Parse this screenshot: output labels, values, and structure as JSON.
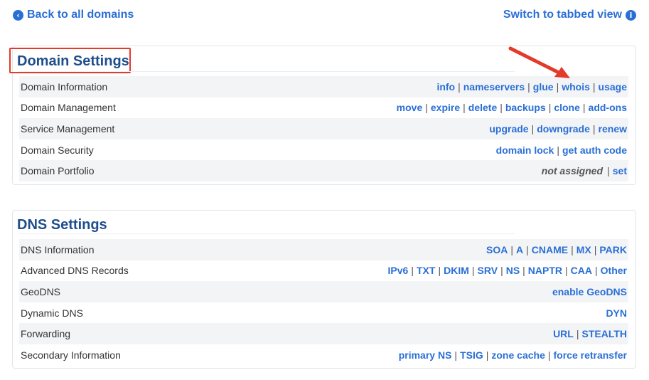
{
  "top": {
    "back_label": "Back to all domains",
    "back_icon": "chevron-left-icon",
    "switch_label": "Switch to tabbed view",
    "switch_icon": "info-icon"
  },
  "domain_settings": {
    "title": "Domain Settings",
    "rows": [
      {
        "label": "Domain Information",
        "links": [
          "info",
          "nameservers",
          "glue",
          "whois",
          "usage"
        ]
      },
      {
        "label": "Domain Management",
        "links": [
          "move",
          "expire",
          "delete",
          "backups",
          "clone",
          "add-ons"
        ]
      },
      {
        "label": "Service Management",
        "links": [
          "upgrade",
          "downgrade",
          "renew"
        ]
      },
      {
        "label": "Domain Security",
        "links": [
          "domain lock",
          "get auth code"
        ]
      },
      {
        "label": "Domain Portfolio",
        "status": "not assigned",
        "links": [
          "set"
        ]
      }
    ]
  },
  "dns_settings": {
    "title": "DNS Settings",
    "rows": [
      {
        "label": "DNS Information",
        "links": [
          "SOA",
          "A",
          "CNAME",
          "MX",
          "PARK"
        ]
      },
      {
        "label": "Advanced DNS Records",
        "links": [
          "IPv6",
          "TXT",
          "DKIM",
          "SRV",
          "NS",
          "NAPTR",
          "CAA",
          "Other"
        ]
      },
      {
        "label": "GeoDNS",
        "links": [
          "enable GeoDNS"
        ]
      },
      {
        "label": "Dynamic DNS",
        "links": [
          "DYN"
        ]
      },
      {
        "label": "Forwarding",
        "links": [
          "URL",
          "STEALTH"
        ]
      },
      {
        "label": "Secondary Information",
        "links": [
          "primary NS",
          "TSIG",
          "zone cache",
          "force retransfer"
        ]
      }
    ]
  },
  "colors": {
    "link": "#2a6fd6",
    "title": "#1f4e8c",
    "highlight": "#e33a2a",
    "row_stripe": "#f3f4f6"
  }
}
